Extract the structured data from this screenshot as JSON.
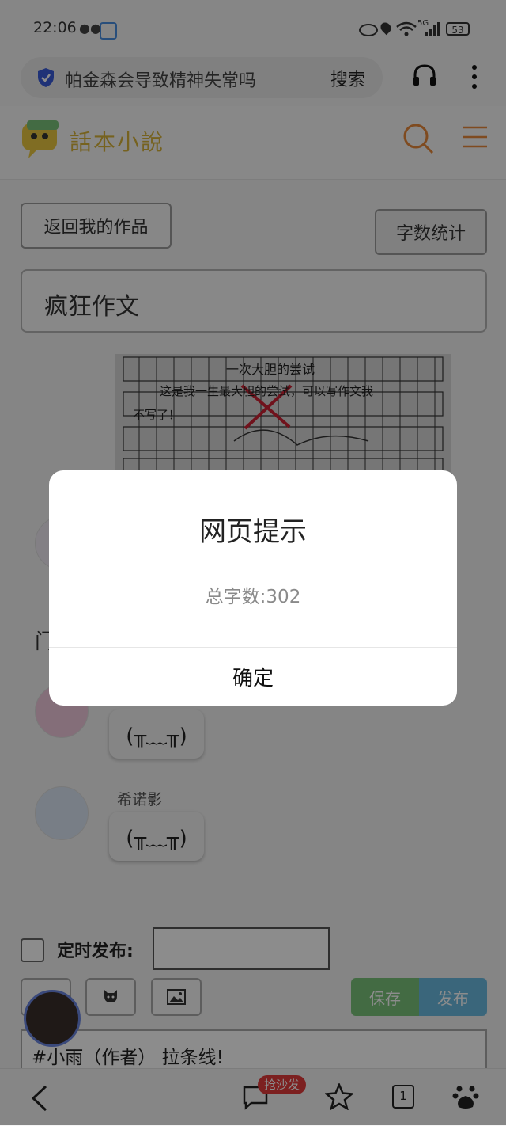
{
  "status_bar": {
    "time": "22:06",
    "network": "5G",
    "battery": "53"
  },
  "browser": {
    "query": "帕金森会导致精神失常吗",
    "search_label": "搜索"
  },
  "site": {
    "logo_text": "話本小說"
  },
  "page": {
    "back_button": "返回我的作品",
    "word_count_button": "字数统计",
    "title": "疯狂作文"
  },
  "paper": {
    "line1": "一次大胆的尝试",
    "line2": "这是我一生最大胆的尝试，可以写作文我",
    "line3": "不写了！"
  },
  "comments": [
    {
      "name": "",
      "text": "(╥﹏╥)"
    },
    {
      "name": "希诺影",
      "text": "(╥﹏╥)"
    }
  ],
  "hidden_fragment": "门",
  "form": {
    "schedule_label": "定时发布:",
    "save_label": "保存",
    "publish_label": "发布",
    "content_text": "#小雨（作者） 拉条线!"
  },
  "nav": {
    "comment_badge": "抢沙发",
    "tab_count": "1"
  },
  "dialog": {
    "title": "网页提示",
    "message": "总字数:302",
    "ok_label": "确定"
  },
  "colors": {
    "save": "#7ac37a",
    "publish": "#6bbbe1",
    "badge": "#e23b3b",
    "accent": "#e8893b"
  }
}
